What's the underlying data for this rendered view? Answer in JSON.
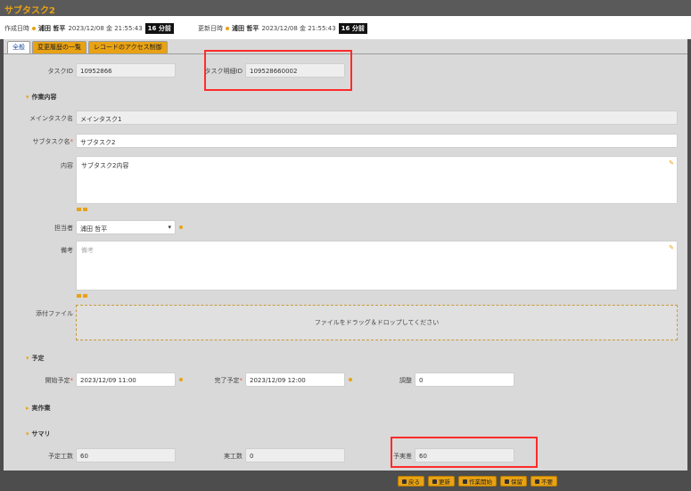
{
  "header": {
    "title": "サブタスク2",
    "created_label": "作成日時",
    "created_user": "浦田 哲平",
    "created_date": "2023/12/08 金 21:55:43",
    "created_ago": "16 分前",
    "updated_label": "更新日時",
    "updated_user": "浦田 哲平",
    "updated_date": "2023/12/08 金 21:55:43",
    "updated_ago": "16 分前"
  },
  "tabs": [
    "全般",
    "変更履歴の一覧",
    "レコードのアクセス制御"
  ],
  "fields": {
    "task_id_label": "タスクID",
    "task_id": "10952866",
    "detail_id_label": "タスク明細ID",
    "detail_id": "109528660002",
    "section_work": "作業内容",
    "main_task_label": "メインタスク名",
    "main_task": "メインタスク1",
    "sub_task_label": "サブタスク名",
    "sub_task": "サブタスク2",
    "content_label": "内容",
    "content": "サブタスク2内容",
    "assignee_label": "担当者",
    "assignee": "浦田 哲平",
    "note_label": "備考",
    "note_placeholder": "備考",
    "attach_label": "添付ファイル",
    "dropzone_text": "ファイルをドラッグ＆ドロップしてください",
    "section_plan": "予定",
    "start_label": "開始予定",
    "start": "2023/12/09 11:00",
    "end_label": "完了予定",
    "end": "2023/12/09 12:00",
    "adjust_label": "調整",
    "adjust": "0",
    "section_actual": "実作業",
    "section_summary": "サマリ",
    "plan_hours_label": "予定工数",
    "plan_hours": "60",
    "actual_hours_label": "実工数",
    "actual_hours": "0",
    "diff_label": "予実差",
    "diff": "60"
  },
  "footer": {
    "back": "戻る",
    "update": "更新",
    "start_work": "作業開始",
    "hold": "保留",
    "unneeded": "不要"
  },
  "colors": {
    "accent": "#e8a214",
    "highlight": "#ff2b2b"
  }
}
